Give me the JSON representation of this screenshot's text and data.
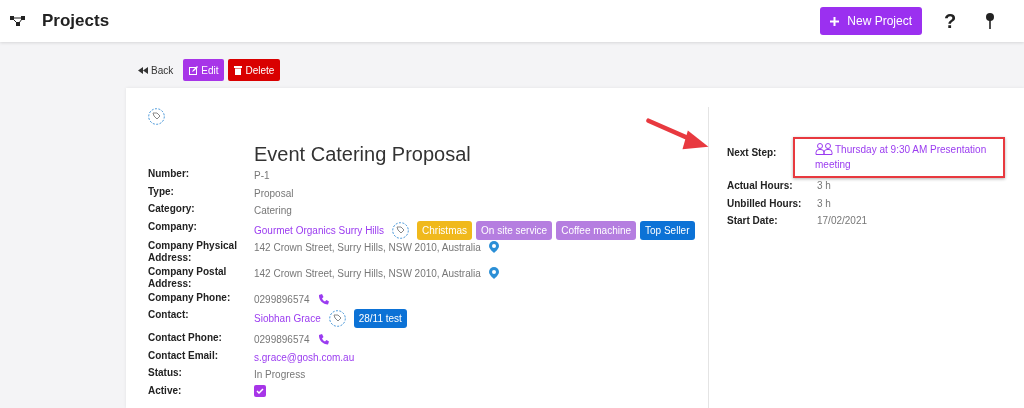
{
  "header": {
    "title": "Projects",
    "new_button": "New Project",
    "help_button": "?"
  },
  "toolbar": [
    {
      "kind": "back",
      "label": "Back"
    },
    {
      "kind": "edit",
      "label": "Edit"
    },
    {
      "kind": "delete",
      "label": "Delete"
    }
  ],
  "project": {
    "title": "Event Catering Proposal",
    "fields": [
      {
        "label": "Number:",
        "value": "P-1",
        "kind": "text"
      },
      {
        "label": "Type:",
        "value": "Proposal",
        "kind": "text"
      },
      {
        "label": "Category:",
        "value": "Catering",
        "kind": "text"
      },
      {
        "label": "Company:",
        "value": "Gourmet Organics Surry Hills",
        "kind": "link",
        "tags": [
          {
            "label": "Christmas",
            "color": "#f0b91c"
          },
          {
            "label": "On site service",
            "color": "#b57ee0"
          },
          {
            "label": "Coffee machine",
            "color": "#b57ee0"
          },
          {
            "label": "Top Seller",
            "color": "#0c72d6"
          }
        ]
      },
      {
        "label": "Company Physical Address:",
        "value": "142 Crown Street, Surry Hills, NSW 2010, Australia",
        "kind": "address"
      },
      {
        "label": "Company Postal Address:",
        "value": "142 Crown Street, Surry Hills, NSW 2010, Australia",
        "kind": "address"
      },
      {
        "label": "Company Phone:",
        "value": "0299896574",
        "kind": "phone"
      },
      {
        "label": "Contact:",
        "value": "Siobhan Grace",
        "kind": "link",
        "tags": [
          {
            "label": "28/11 test",
            "color": "#0c72d6"
          }
        ]
      },
      {
        "label": "Contact Phone:",
        "value": "0299896574",
        "kind": "phone"
      },
      {
        "label": "Contact Email:",
        "value": "s.grace@gosh.com.au",
        "kind": "link"
      },
      {
        "label": "Status:",
        "value": "In Progress",
        "kind": "text"
      },
      {
        "label": "Active:",
        "checked": true,
        "kind": "checkbox"
      }
    ],
    "side_fields": [
      {
        "label": "Next Step:",
        "value": "Thursday at 9:30 AM Presentation meeting",
        "kind": "meeting"
      },
      {
        "label": "Actual Hours:",
        "value": "3 h",
        "kind": "text"
      },
      {
        "label": "Unbilled Hours:",
        "value": "3 h",
        "kind": "text"
      },
      {
        "label": "Start Date:",
        "value": "17/02/2021",
        "kind": "text"
      }
    ]
  }
}
